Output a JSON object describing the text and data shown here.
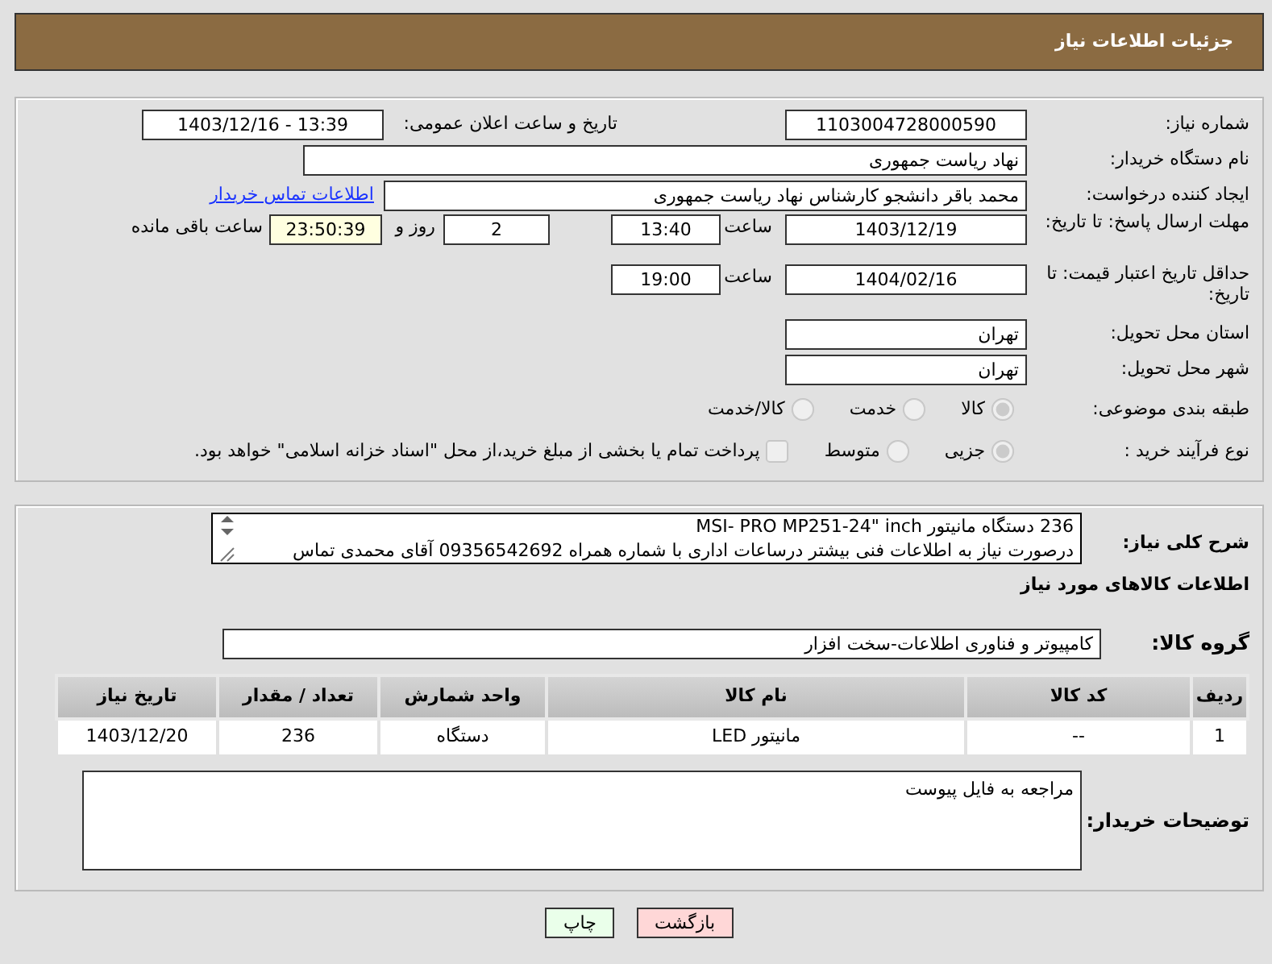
{
  "header": {
    "title": "جزئیات اطلاعات نیاز"
  },
  "need_number": {
    "label": "شماره نیاز:",
    "value": "1103004728000590"
  },
  "announce": {
    "label": "تاریخ و ساعت اعلان عمومی:",
    "value": "1403/12/16 - 13:39"
  },
  "buyer_org": {
    "label": "نام دستگاه خریدار:",
    "value": "نهاد ریاست جمهوری"
  },
  "requester": {
    "label": "ایجاد کننده درخواست:",
    "value": "محمد باقر دانشجو کارشناس نهاد ریاست جمهوری",
    "link": "اطلاعات تماس خریدار"
  },
  "reply_deadline": {
    "label": "مهلت ارسال پاسخ: تا تاریخ:",
    "date": "1403/12/19",
    "time_label": "ساعت",
    "time": "13:40",
    "days": "2",
    "days_label": "روز و",
    "remaining": "23:50:39",
    "remaining_label": "ساعت باقی مانده"
  },
  "price_validity": {
    "label": "حداقل تاریخ اعتبار قیمت: تا تاریخ:",
    "date": "1404/02/16",
    "time_label": "ساعت",
    "time": "19:00"
  },
  "province": {
    "label": "استان محل تحویل:",
    "value": "تهران"
  },
  "city": {
    "label": "شهر محل تحویل:",
    "value": "تهران"
  },
  "category": {
    "label": "طبقه بندی موضوعی:",
    "options": [
      {
        "label": "کالا",
        "selected": true
      },
      {
        "label": "خدمت",
        "selected": false
      },
      {
        "label": "کالا/خدمت",
        "selected": false
      }
    ]
  },
  "process": {
    "label": "نوع فرآیند خرید :",
    "options": [
      {
        "label": "جزیی",
        "selected": true
      },
      {
        "label": "متوسط",
        "selected": false
      }
    ],
    "payment_note": {
      "label": "پرداخت تمام یا بخشی از مبلغ خرید،از محل \"اسناد خزانه اسلامی\" خواهد بود.",
      "checked": false
    }
  },
  "description": {
    "label": "شرح کلی نیاز:",
    "lines": [
      "236 دستگاه مانیتور MSI- PRO MP251-24\" inch",
      "درصورت نیاز به اطلاعات فنی بیشتر درساعات اداری با شماره همراه 09356542692 آقای محمدی تماس"
    ]
  },
  "goods_heading": "اطلاعات کالاهای مورد نیاز",
  "goods_group": {
    "label": "گروه کالا:",
    "value": "کامپیوتر و فناوری اطلاعات-سخت افزار"
  },
  "table": {
    "columns": [
      "ردیف",
      "کد کالا",
      "نام کالا",
      "واحد شمارش",
      "تعداد / مقدار",
      "تاریخ نیاز"
    ],
    "rows": [
      [
        "1",
        "--",
        "مانیتور LED",
        "دستگاه",
        "236",
        "1403/12/20"
      ]
    ]
  },
  "buyer_notes": {
    "label": "توضیحات خریدار:",
    "value": "مراجعه به فایل پیوست"
  },
  "buttons": [
    {
      "label": "بازگشت",
      "kind": "back"
    },
    {
      "label": "چاپ",
      "kind": "print"
    }
  ]
}
